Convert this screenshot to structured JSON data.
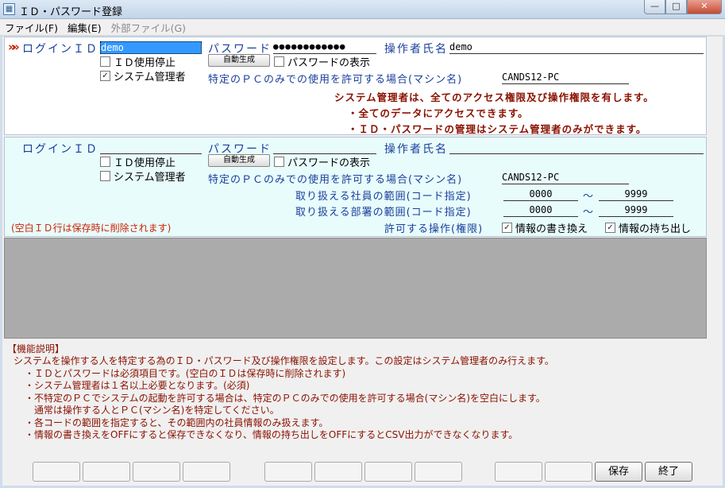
{
  "window": {
    "title": "ＩＤ・パスワード登録",
    "icon": "form-icon",
    "minimize": "—",
    "maximize": "□",
    "close": "✕"
  },
  "menu": [
    {
      "label": "ファイル(F)",
      "enabled": true
    },
    {
      "label": "編集(E)",
      "enabled": true
    },
    {
      "label": "外部ファイル(G)",
      "enabled": false
    }
  ],
  "record1": {
    "marker": "»",
    "login_id_label": "ログインＩＤ",
    "login_id_value": "demo",
    "password_label": "パスワード",
    "password_value": "●●●●●●●●●●●●",
    "operator_label": "操作者氏名",
    "operator_value": "demo",
    "id_stop_label": "ＩＤ使用停止",
    "id_stop_checked": false,
    "sysadmin_label": "システム管理者",
    "sysadmin_checked": true,
    "autogen_label": "自動生成",
    "show_password_label": "パスワードの表示",
    "show_password_checked": false,
    "machine_label": "特定のＰＣのみでの使用を許可する場合(マシン名)",
    "machine_value": "CANDS12-PC",
    "admin_note_1": "システム管理者は、全てのアクセス権限及び操作権限を有します。",
    "admin_note_2": "・全てのデータにアクセスできます。",
    "admin_note_3": "・ＩＤ・パスワードの管理はシステム管理者のみができます。"
  },
  "record2": {
    "login_id_label": "ログインＩＤ",
    "login_id_value": "",
    "password_label": "パスワード",
    "password_value": "",
    "operator_label": "操作者氏名",
    "operator_value": "",
    "id_stop_label": "ＩＤ使用停止",
    "id_stop_checked": false,
    "sysadmin_label": "システム管理者",
    "sysadmin_checked": false,
    "autogen_label": "自動生成",
    "show_password_label": "パスワードの表示",
    "show_password_checked": false,
    "machine_label": "特定のＰＣのみでの使用を許可する場合(マシン名)",
    "machine_value": "CANDS12-PC",
    "employee_range_label": "取り扱える社員の範囲(コード指定)",
    "employee_from": "0000",
    "employee_to": "9999",
    "dept_range_label": "取り扱える部署の範囲(コード指定)",
    "dept_from": "0000",
    "dept_to": "9999",
    "range_sep": "～",
    "blank_note": "(空白ＩＤ行は保存時に削除されます)",
    "permission_label": "許可する操作(権限)",
    "rewrite_label": "情報の書き換え",
    "rewrite_checked": true,
    "export_label": "情報の持ち出し",
    "export_checked": true
  },
  "help": {
    "title": "【機能説明】",
    "lines": [
      "システムを操作する人を特定する為のＩＤ・パスワード及び操作権限を設定します。この設定はシステム管理者のみ行えます。",
      "・ＩＤとパスワードは必須項目です。(空白のＩＤは保存時に削除されます)",
      "・システム管理者は１名以上必要となります。(必須)",
      "・不特定のＰＣでシステムの起動を許可する場合は、特定のＰＣのみでの使用を許可する場合(マシン名)を空白にします。",
      "　通常は操作する人とＰＣ(マシン名)を特定してください。",
      "・各コードの範囲を指定すると、その範囲内の社員情報のみ扱えます。",
      "・情報の書き換えをOFFにすると保存できなくなり、情報の持ち出しをOFFにするとCSV出力ができなくなります。"
    ]
  },
  "buttons": {
    "save": "保存",
    "exit": "終了"
  },
  "colors": {
    "label_blue": "#1a3f9c",
    "warning_red": "#8a1100",
    "selected_field": "#3399ff",
    "record2_bg": "#e8fcfc"
  }
}
